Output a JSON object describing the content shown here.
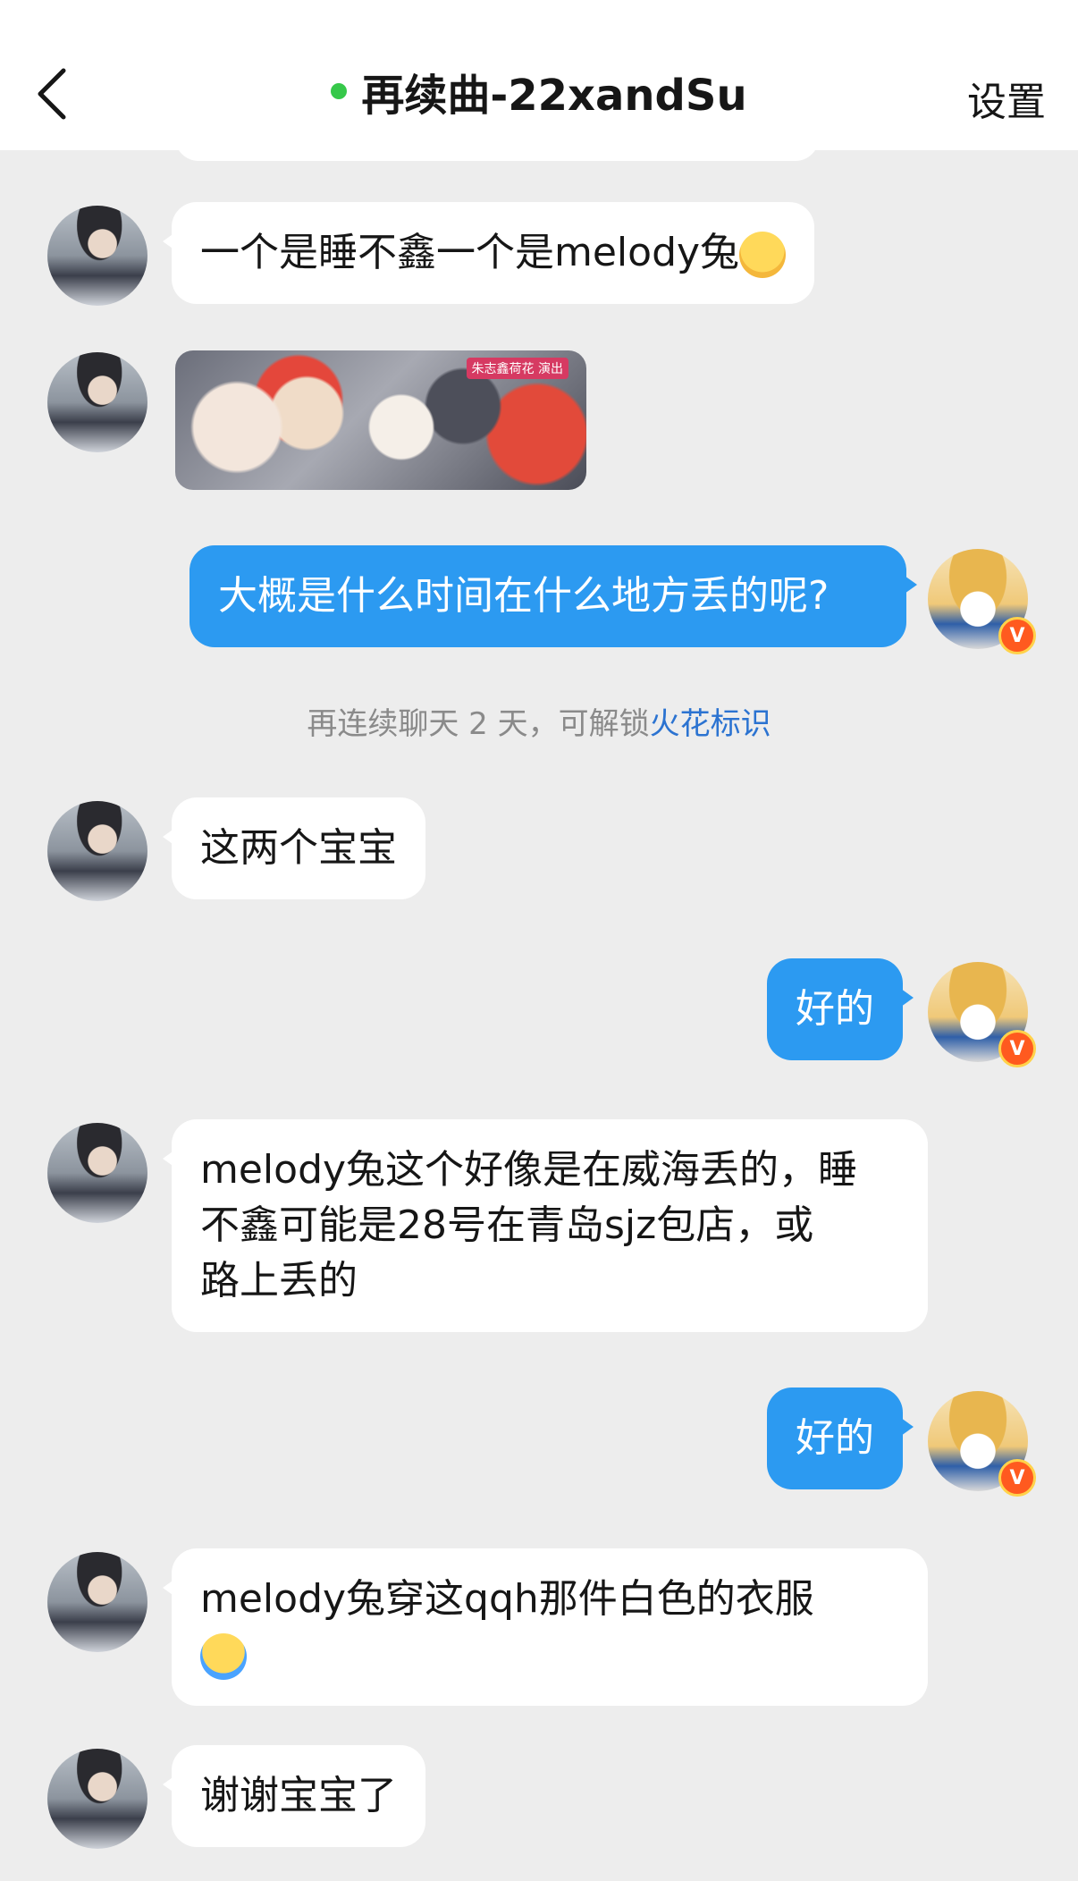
{
  "header": {
    "title": "再续曲-22xandSu",
    "settings_label": "设置",
    "online_color": "#36c84a",
    "back_icon": "chevron-left-icon"
  },
  "messages": [
    {
      "side": "in",
      "text": "一个是睡不鑫一个是melody兔",
      "emoji": "pray-emoji"
    },
    {
      "side": "in",
      "type": "image",
      "image_caption": "朱志鑫荷花 演出"
    },
    {
      "side": "out",
      "text": "大概是什么时间在什么地方丢的呢?"
    },
    {
      "side": "in",
      "text": "这两个宝宝"
    },
    {
      "side": "out",
      "text": "好的"
    },
    {
      "side": "in",
      "text_lines": [
        "melody兔这个好像是在威海丢的，睡",
        "不鑫可能是28号在青岛sjz包店，或",
        "路上丢的"
      ]
    },
    {
      "side": "out",
      "text": "好的"
    },
    {
      "side": "in",
      "text": "melody兔穿这qqh那件白色的衣服",
      "emoji": "crying-emoji"
    },
    {
      "side": "in",
      "text": "谢谢宝宝了"
    }
  ],
  "system_note": {
    "prefix": "再连续聊天 2 天，可解锁",
    "link": "火花标识"
  },
  "colors": {
    "outgoing_bubble": "#2c9af1",
    "incoming_bubble": "#ffffff",
    "background": "#ededed",
    "badge": "#ff5a1f"
  },
  "badge_letter": "V"
}
